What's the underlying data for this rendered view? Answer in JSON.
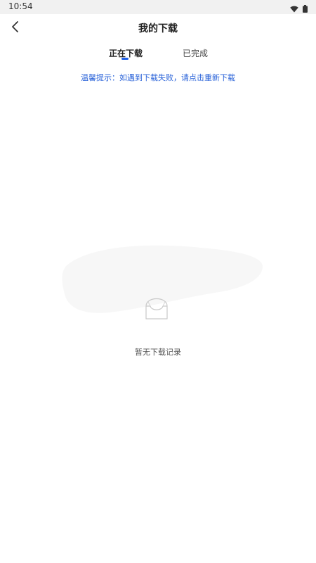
{
  "status_bar": {
    "time": "10:54",
    "icons": [
      "wifi-icon",
      "battery-icon"
    ]
  },
  "header": {
    "title": "我的下载",
    "back_icon": "chevron-left-icon"
  },
  "tabs": [
    {
      "label": "正在下载",
      "active": true
    },
    {
      "label": "已完成",
      "active": false
    }
  ],
  "tip": "温馨提示：如遇到下载失败，请点击重新下载",
  "empty_state": {
    "icon": "empty-box-icon",
    "text": "暂无下载记录"
  },
  "colors": {
    "accent": "#1f5fe6",
    "tip_text": "#2a63d9",
    "status_bar_bg": "#f1f1f1"
  }
}
